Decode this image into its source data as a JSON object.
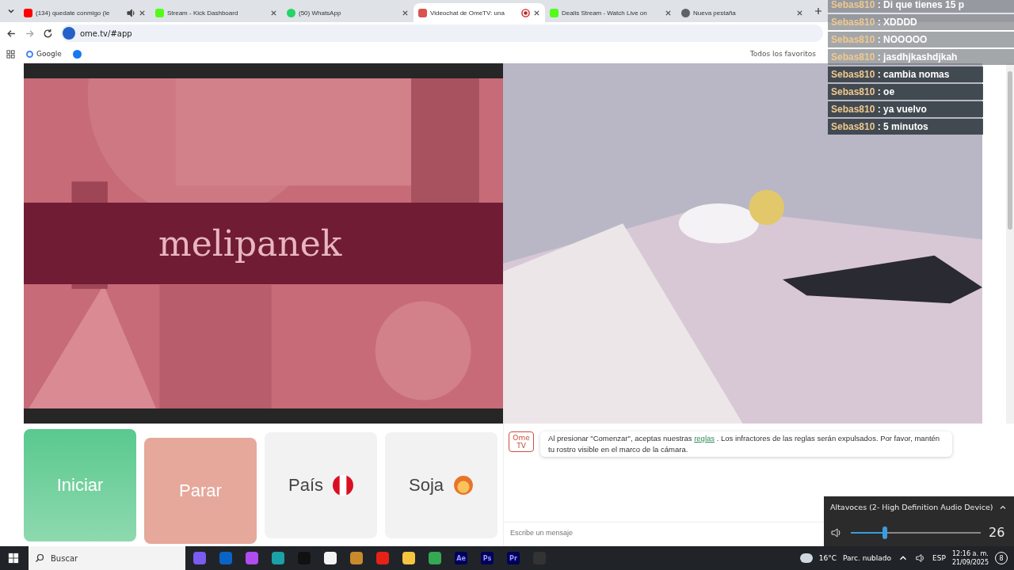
{
  "browser": {
    "tabs": [
      {
        "title": "(134) quedate conmigo (le",
        "kind": "youtube",
        "selected": false,
        "audio": true,
        "recording": false
      },
      {
        "title": "Stream - Kick Dashboard",
        "kind": "kick",
        "selected": false,
        "audio": false,
        "recording": false
      },
      {
        "title": "(50) WhatsApp",
        "kind": "whatsapp",
        "selected": false,
        "audio": false,
        "recording": false
      },
      {
        "title": "Videochat de OmeTV: una",
        "kind": "ometv",
        "selected": true,
        "audio": false,
        "recording": true
      },
      {
        "title": "Dealis Stream - Watch Live on",
        "kind": "kick",
        "selected": false,
        "audio": false,
        "recording": false
      },
      {
        "title": "Nueva pestaña",
        "kind": "globe",
        "selected": false,
        "audio": false,
        "recording": false
      }
    ],
    "address": "ome.tv/#app",
    "bookmark": "Google",
    "favorites": "Todos los favoritos"
  },
  "stream_chat": [
    {
      "user": "Sebas810",
      "text": ": Di que tienes 15 p"
    },
    {
      "user": "Sebas810",
      "text": ": XDDDD"
    },
    {
      "user": "Sebas810",
      "text": ": NOOOOO"
    },
    {
      "user": "Sebas810",
      "text": ": jasdhjkashdjkah"
    },
    {
      "user": "Sebas810",
      "text": ": cambia nomas"
    },
    {
      "user": "Sebas810",
      "text": ": oe"
    },
    {
      "user": "Sebas810",
      "text": ": ya vuelvo"
    },
    {
      "user": "Sebas810",
      "text": ": 5 minutos"
    }
  ],
  "video": {
    "channel_name": "melipanek"
  },
  "controls": [
    {
      "label": "Iniciar",
      "kind": "start"
    },
    {
      "label": "Parar",
      "kind": "stop"
    },
    {
      "label": "País",
      "kind": "country"
    },
    {
      "label": "Soja",
      "kind": "gender"
    }
  ],
  "chat": {
    "logo_top": "Ome",
    "logo_bottom": "TV",
    "notice": "Al presionar \"Comenzar\", aceptas nuestras",
    "link": "reglas",
    "notice_rest": ". Los infractores de las reglas serán expulsados. Por favor, mantén tu rostro visible en el marco de la cámara.",
    "placeholder": "Escribe un mensaje"
  },
  "volume": {
    "device": "Altavoces (2- High Definition Audio Device)",
    "level": 0.26,
    "reading": "26"
  },
  "taskbar": {
    "search": "Buscar",
    "apps": [
      {
        "kind": "copilot"
      },
      {
        "kind": "outlook"
      },
      {
        "kind": "drop"
      },
      {
        "kind": "edge"
      },
      {
        "kind": "tiktok"
      },
      {
        "kind": "store"
      },
      {
        "kind": "shield"
      },
      {
        "kind": "play"
      },
      {
        "kind": "folder"
      },
      {
        "kind": "chrome"
      },
      {
        "kind": "adobe",
        "label": "Ae"
      },
      {
        "kind": "adobe",
        "label": "Ps"
      },
      {
        "kind": "adobe",
        "label": "Pr"
      },
      {
        "kind": "obs"
      }
    ],
    "temperature": "16°C",
    "weather": "Parc. nublado",
    "language": "ESP",
    "time": "12:16 a. m.",
    "date": "21/09/2025",
    "notifications": "8"
  }
}
